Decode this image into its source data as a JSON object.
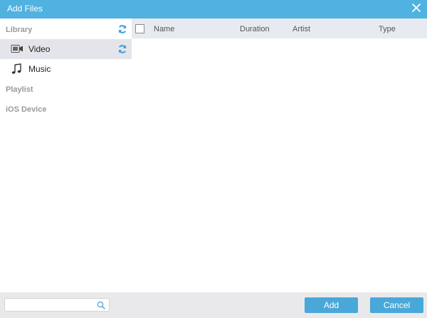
{
  "window": {
    "title": "Add Files"
  },
  "sidebar": {
    "library_label": "Library",
    "items": [
      {
        "label": "Video",
        "icon": "video-camera-icon",
        "selected": true
      },
      {
        "label": "Music",
        "icon": "music-note-icon",
        "selected": false
      }
    ],
    "playlist_label": "Playlist",
    "ios_device_label": "iOS Device"
  },
  "table": {
    "columns": [
      "Name",
      "Duration",
      "Artist",
      "Type"
    ],
    "rows": []
  },
  "footer": {
    "search_placeholder": "",
    "add_label": "Add",
    "cancel_label": "Cancel"
  },
  "colors": {
    "accent": "#4fb2e0",
    "button": "#4aa8d8",
    "refresh_icon": "#3a9fdc"
  }
}
